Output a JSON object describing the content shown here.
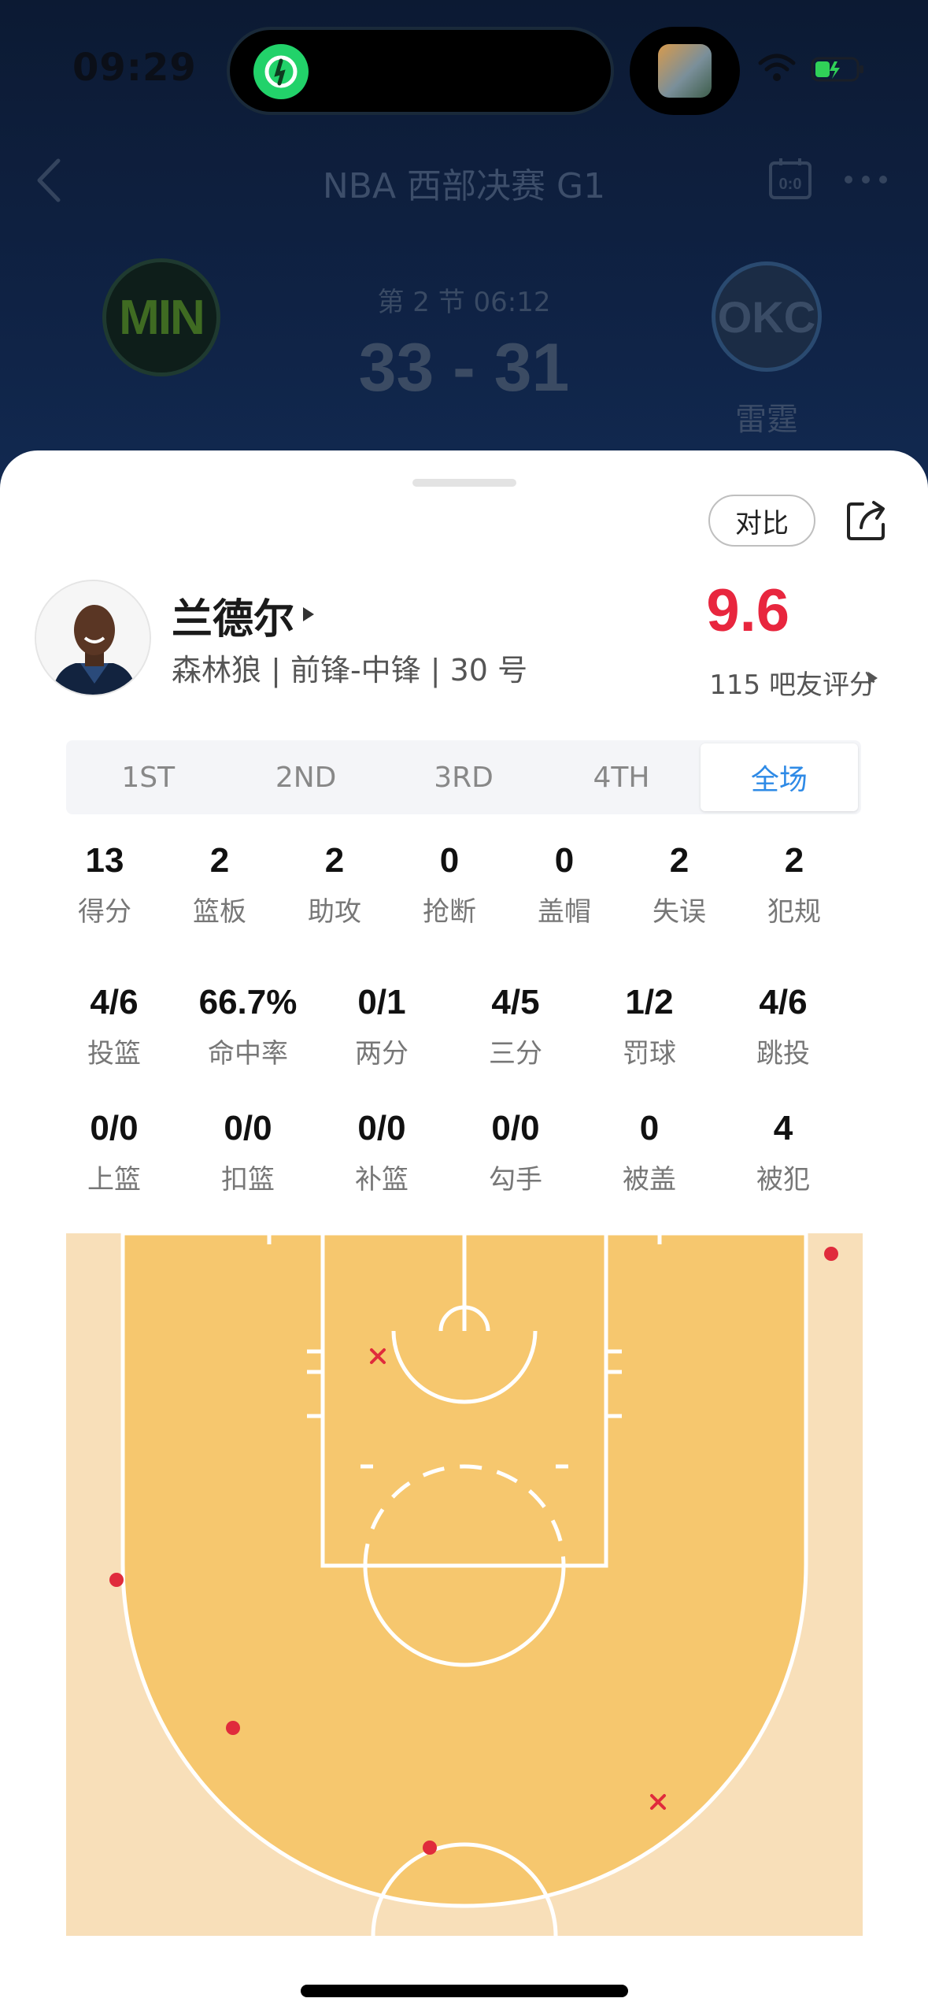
{
  "status_bar": {
    "time": "09:29"
  },
  "nav": {
    "title": "NBA 西部决赛 G1"
  },
  "game": {
    "period": "第 2 节 06:12",
    "score": "33 - 31",
    "home_abbr": "MIN",
    "away_abbr": "OKC",
    "away_name": "雷霆"
  },
  "sheet": {
    "compare_label": "对比",
    "player": {
      "name": "兰德尔",
      "meta": "森林狼 | 前锋-中锋 | 30 号",
      "rating": "9.6",
      "rating_count": "115 吧友评分"
    },
    "tabs": [
      {
        "label": "1ST",
        "active": false
      },
      {
        "label": "2ND",
        "active": false
      },
      {
        "label": "3RD",
        "active": false
      },
      {
        "label": "4TH",
        "active": false
      },
      {
        "label": "全场",
        "active": true
      }
    ],
    "stats_row1": [
      {
        "value": "13",
        "label": "得分"
      },
      {
        "value": "2",
        "label": "篮板"
      },
      {
        "value": "2",
        "label": "助攻"
      },
      {
        "value": "0",
        "label": "抢断"
      },
      {
        "value": "0",
        "label": "盖帽"
      },
      {
        "value": "2",
        "label": "失误"
      },
      {
        "value": "2",
        "label": "犯规"
      }
    ],
    "stats_row2": [
      {
        "value": "4/6",
        "label": "投篮"
      },
      {
        "value": "66.7%",
        "label": "命中率"
      },
      {
        "value": "0/1",
        "label": "两分"
      },
      {
        "value": "4/5",
        "label": "三分"
      },
      {
        "value": "1/2",
        "label": "罚球"
      },
      {
        "value": "4/6",
        "label": "跳投"
      }
    ],
    "stats_row3": [
      {
        "value": "0/0",
        "label": "上篮"
      },
      {
        "value": "0/0",
        "label": "扣篮"
      },
      {
        "value": "0/0",
        "label": "补篮"
      },
      {
        "value": "0/0",
        "label": "勾手"
      },
      {
        "value": "0",
        "label": "被盖"
      },
      {
        "value": "4",
        "label": "被犯"
      }
    ],
    "shot_chart": {
      "made_color": "#e02b3c",
      "missed_color": "#e02b3c",
      "court_color": "#f6c76e",
      "outer_color": "#f8dfb9"
    }
  }
}
